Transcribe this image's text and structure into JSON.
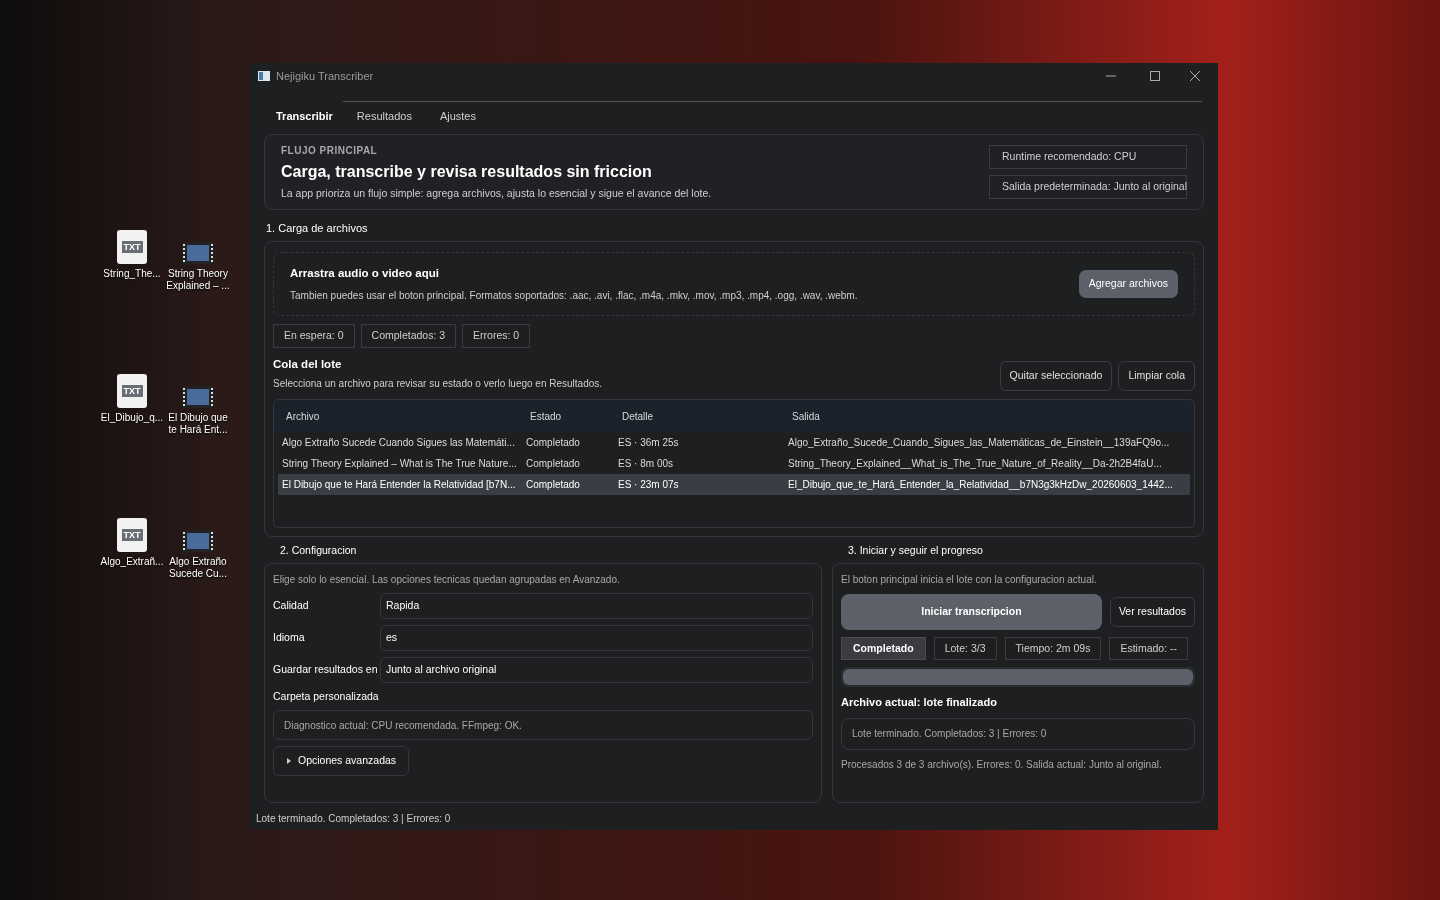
{
  "desktop": {
    "icons": [
      {
        "kind": "txt",
        "badge": "TXT",
        "label": "String_The..."
      },
      {
        "kind": "video",
        "label": "String Theory Explained – ..."
      },
      {
        "kind": "txt",
        "badge": "TXT",
        "label": "El_Dibujo_q..."
      },
      {
        "kind": "video",
        "label": "El Dibujo que te Hará Ent..."
      },
      {
        "kind": "txt",
        "badge": "TXT",
        "label": "Algo_Extrañ..."
      },
      {
        "kind": "video",
        "label": "Algo Extraño Sucede Cu..."
      }
    ]
  },
  "window": {
    "title": "Nejigiku Transcriber"
  },
  "tabs": [
    {
      "label": "Transcribir",
      "selected": true
    },
    {
      "label": "Resultados",
      "selected": false
    },
    {
      "label": "Ajustes",
      "selected": false
    }
  ],
  "hero": {
    "eyebrow": "FLUJO PRINCIPAL",
    "title": "Carga, transcribe y revisa resultados sin friccion",
    "subtitle": "La app prioriza un flujo simple: agrega archivos, ajusta lo esencial y sigue el avance del lote.",
    "chips": [
      "Runtime recomendado: CPU",
      "Salida predeterminada: Junto al original"
    ]
  },
  "upload": {
    "section_title": "1. Carga de archivos",
    "drop_title": "Arrastra audio o video aqui",
    "drop_text": "Tambien puedes usar el boton principal. Formatos soportados: .aac, .avi, .flac, .m4a, .mkv, .mov, .mp3, .mp4, .ogg, .wav, .webm.",
    "button": "Agregar archivos"
  },
  "counters": [
    "En espera: 0",
    "Completados: 3",
    "Errores: 0"
  ],
  "queue": {
    "title": "Cola del lote",
    "subtitle": "Selecciona un archivo para revisar su estado o verlo luego en Resultados.",
    "buttons": [
      "Quitar seleccionado",
      "Limpiar cola"
    ],
    "columns": [
      "Archivo",
      "Estado",
      "Detalle",
      "Salida"
    ],
    "rows": [
      {
        "cells": [
          "Algo Extraño Sucede Cuando Sigues las Matemáti...",
          "Completado",
          "ES · 36m 25s",
          "Algo_Extraño_Sucede_Cuando_Sigues_las_Matemáticas_de_Einstein__139aFQ9o..."
        ],
        "selected": false
      },
      {
        "cells": [
          "String Theory Explained – What is The True Nature...",
          "Completado",
          "ES · 8m 00s",
          "String_Theory_Explained__What_is_The_True_Nature_of_Reality__Da-2h2B4faU..."
        ],
        "selected": false
      },
      {
        "cells": [
          "El Dibujo que te Hará Entender la Relatividad [b7N...",
          "Completado",
          "ES · 23m 07s",
          "El_Dibujo_que_te_Hará_Entender_la_Relatividad__b7N3g3kHzDw_20260603_1442..."
        ],
        "selected": true
      }
    ]
  },
  "config": {
    "title": "2. Configuracion",
    "hint": "Elige solo lo esencial. Las opciones tecnicas quedan agrupadas en Avanzado.",
    "fields": [
      {
        "label": "Calidad",
        "value": "Rapida"
      },
      {
        "label": "Idioma",
        "value": "es"
      },
      {
        "label": "Guardar resultados en",
        "value": "Junto al archivo original"
      }
    ],
    "custom_folder_label": "Carpeta personalizada",
    "diagnostic": "Diagnostico actual: CPU recomendada. FFmpeg: OK.",
    "advanced": {
      "label": "Opciones avanzadas",
      "expanded": false
    }
  },
  "progress": {
    "title": "3. Iniciar y seguir el progreso",
    "hint": "El boton principal inicia el lote con la configuracion actual.",
    "start_button": "Iniciar transcripcion",
    "results_button": "Ver resultados",
    "chips": [
      {
        "label": "Completado",
        "selected": true
      },
      {
        "label": "Lote: 3/3",
        "selected": false
      },
      {
        "label": "Tiempo: 2m 09s",
        "selected": false
      },
      {
        "label": "Estimado: --",
        "selected": false
      }
    ],
    "level": 1,
    "current_file": "Archivo actual: lote finalizado",
    "log": "Lote terminado. Completados: 3 | Errores: 0",
    "summary": "Procesados 3 de 3 archivo(s). Errores: 0. Salida actual: Junto al original."
  },
  "status_bar": "Lote terminado. Completados: 3 | Errores: 0"
}
